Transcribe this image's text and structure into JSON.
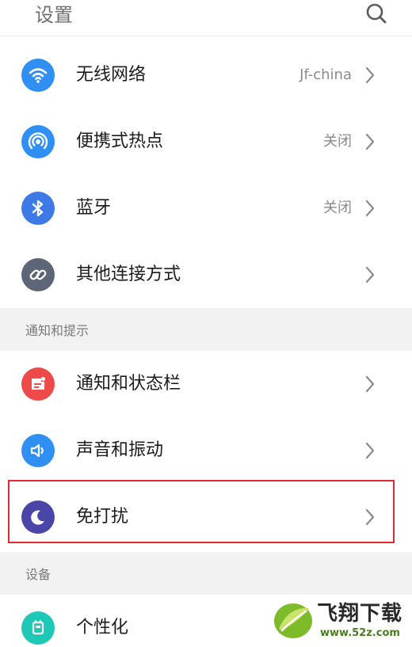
{
  "header": {
    "title": "设置",
    "search_icon": "search-icon"
  },
  "colors": {
    "wifi": "#2f8ff2",
    "hotspot": "#2f8ff2",
    "bluetooth": "#3d7ae6",
    "other_connect": "#5d6677",
    "notification": "#ef4a4a",
    "sound": "#2f8ff2",
    "dnd": "#4a46a8",
    "personalize": "#1fc7b6",
    "highlight": "#e0292f",
    "section_bg": "#f2f2f2"
  },
  "connectivity": {
    "wifi": {
      "label": "无线网络",
      "value": "Jf-china",
      "icon": "wifi-icon"
    },
    "hotspot": {
      "label": "便携式热点",
      "value": "关闭",
      "icon": "hotspot-icon"
    },
    "bluetooth": {
      "label": "蓝牙",
      "value": "关闭",
      "icon": "bluetooth-icon"
    },
    "other": {
      "label": "其他连接方式",
      "value": "",
      "icon": "link-icon"
    }
  },
  "notifications_section": {
    "title": "通知和提示",
    "notification_bar": {
      "label": "通知和状态栏",
      "icon": "notification-icon"
    },
    "sound_vibration": {
      "label": "声音和振动",
      "icon": "speaker-icon"
    },
    "dnd": {
      "label": "免打扰",
      "icon": "moon-icon"
    }
  },
  "device_section": {
    "title": "设备",
    "personalize": {
      "label": "个性化",
      "icon": "personalize-icon"
    }
  },
  "watermark": {
    "name": "飞翔下载",
    "url": "www.52z.com"
  }
}
